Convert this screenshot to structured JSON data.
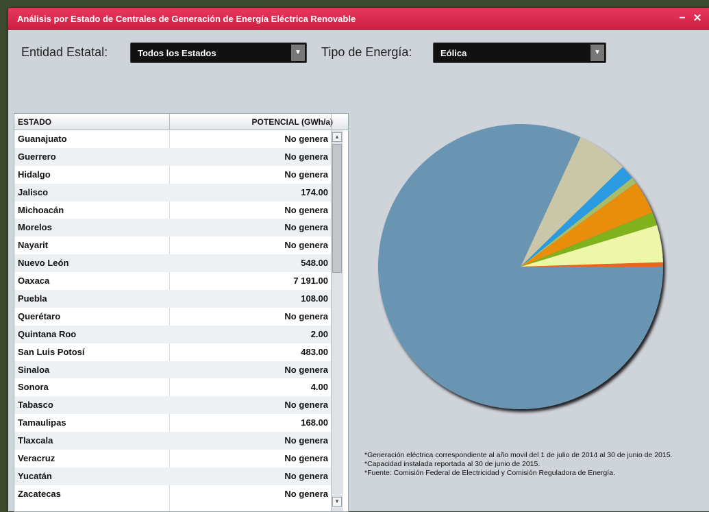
{
  "window": {
    "title": "Análisis por Estado de Centrales de Generación de Energía Eléctrica Renovable",
    "minimize_glyph": "−",
    "close_glyph": "✕"
  },
  "filters": {
    "state_label": "Entidad Estatal:",
    "state_value": "Todos los Estados",
    "energy_label": "Tipo de Energía:",
    "energy_value": "Eólica"
  },
  "table": {
    "headers": [
      "ESTADO",
      "POTENCIAL (GWh/a)"
    ],
    "rows": [
      {
        "estado": "Guanajuato",
        "potencial": "No genera"
      },
      {
        "estado": "Guerrero",
        "potencial": "No genera"
      },
      {
        "estado": "Hidalgo",
        "potencial": "No genera"
      },
      {
        "estado": "Jalisco",
        "potencial": "174.00"
      },
      {
        "estado": "Michoacán",
        "potencial": "No genera"
      },
      {
        "estado": "Morelos",
        "potencial": "No genera"
      },
      {
        "estado": "Nayarit",
        "potencial": "No genera"
      },
      {
        "estado": "Nuevo León",
        "potencial": "548.00"
      },
      {
        "estado": "Oaxaca",
        "potencial": "7 191.00"
      },
      {
        "estado": "Puebla",
        "potencial": "108.00"
      },
      {
        "estado": "Querétaro",
        "potencial": "No genera"
      },
      {
        "estado": "Quintana Roo",
        "potencial": "2.00"
      },
      {
        "estado": "San Luis Potosí",
        "potencial": "483.00"
      },
      {
        "estado": "Sinaloa",
        "potencial": "No genera"
      },
      {
        "estado": "Sonora",
        "potencial": "4.00"
      },
      {
        "estado": "Tabasco",
        "potencial": "No genera"
      },
      {
        "estado": "Tamaulipas",
        "potencial": "168.00"
      },
      {
        "estado": "Tlaxcala",
        "potencial": "No genera"
      },
      {
        "estado": "Veracruz",
        "potencial": "No genera"
      },
      {
        "estado": "Yucatán",
        "potencial": "No genera"
      },
      {
        "estado": "Zacatecas",
        "potencial": "No genera"
      }
    ],
    "scroll_up_glyph": "▲",
    "scroll_down_glyph": "▼"
  },
  "notes": [
    "*Generación eléctrica correspondiente al año movil del 1 de julio de 2014 al 30 de junio de 2015.",
    "*Capacidad instalada reportada al 30 de junio de 2015.",
    "*Fuente: Comisión Federal de Electricidad y Comisión Reguladora de Energía."
  ],
  "colors": {
    "title_bar": "#d9284d",
    "window_bg": "#cfd3da"
  },
  "chart_data": {
    "type": "pie",
    "start_angle_deg": 0,
    "direction": "counterclockwise",
    "slices": [
      {
        "value": 0.5,
        "color": "#e8642c"
      },
      {
        "value": 4.2,
        "color": "#eef7a8"
      },
      {
        "value": 1.5,
        "color": "#7fb21e"
      },
      {
        "value": 3.8,
        "color": "#e98d0c"
      },
      {
        "value": 0.7,
        "color": "#a8bd6a"
      },
      {
        "value": 1.6,
        "color": "#2a9be0"
      },
      {
        "value": 5.8,
        "color": "#c9c7a8"
      },
      {
        "value": 81.9,
        "color": "#6b95b2"
      }
    ]
  }
}
